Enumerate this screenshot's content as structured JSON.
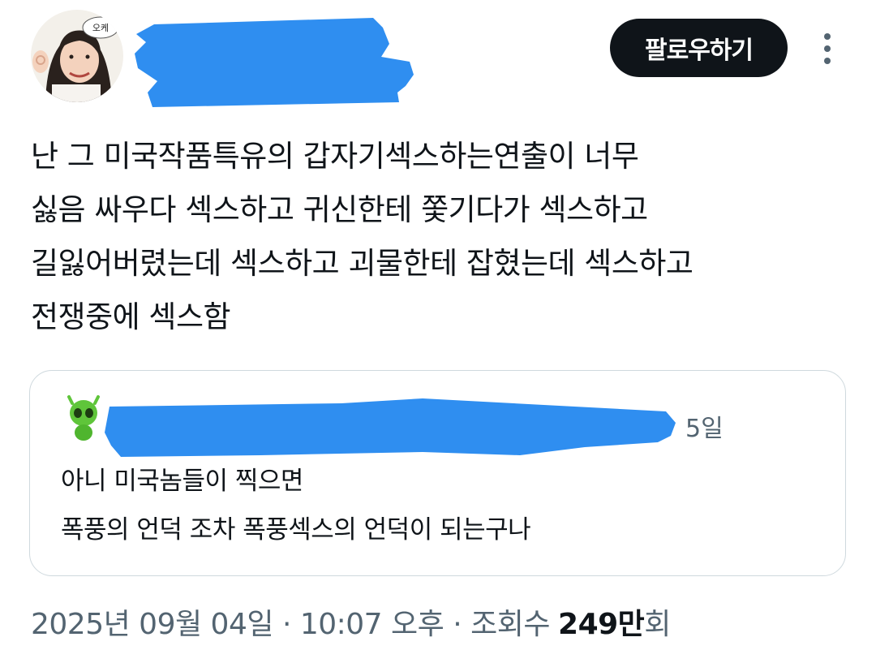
{
  "avatar": {
    "speech_bubble": "오케"
  },
  "header": {
    "follow_label": "팔로우하기",
    "more_icon": "more-vertical-icon"
  },
  "tweet": {
    "lines": [
      "난 그 미국작품특유의 갑자기섹스하는연출이 너무",
      "싫음 싸우다 섹스하고 귀신한테 쫓기다가 섹스하고",
      "길잃어버렸는데 섹스하고 괴물한테 잡혔는데 섹스하고",
      "전쟁중에 섹스함"
    ]
  },
  "quote": {
    "time": "5일",
    "lines": [
      "아니 미국놈들이 찍으면",
      "폭풍의 언덕 조차 폭풍섹스의 언덕이 되는구나"
    ]
  },
  "meta": {
    "date": "2025년 09월 04일",
    "separator": "·",
    "time": "10:07 오후",
    "views_label": "조회수",
    "views_value": "249만",
    "views_suffix": "회"
  },
  "colors": {
    "redaction": "#2f8ef0",
    "text_primary": "#0f1419",
    "text_secondary": "#536471",
    "border": "#cfd9de",
    "button_bg": "#0f1419"
  }
}
